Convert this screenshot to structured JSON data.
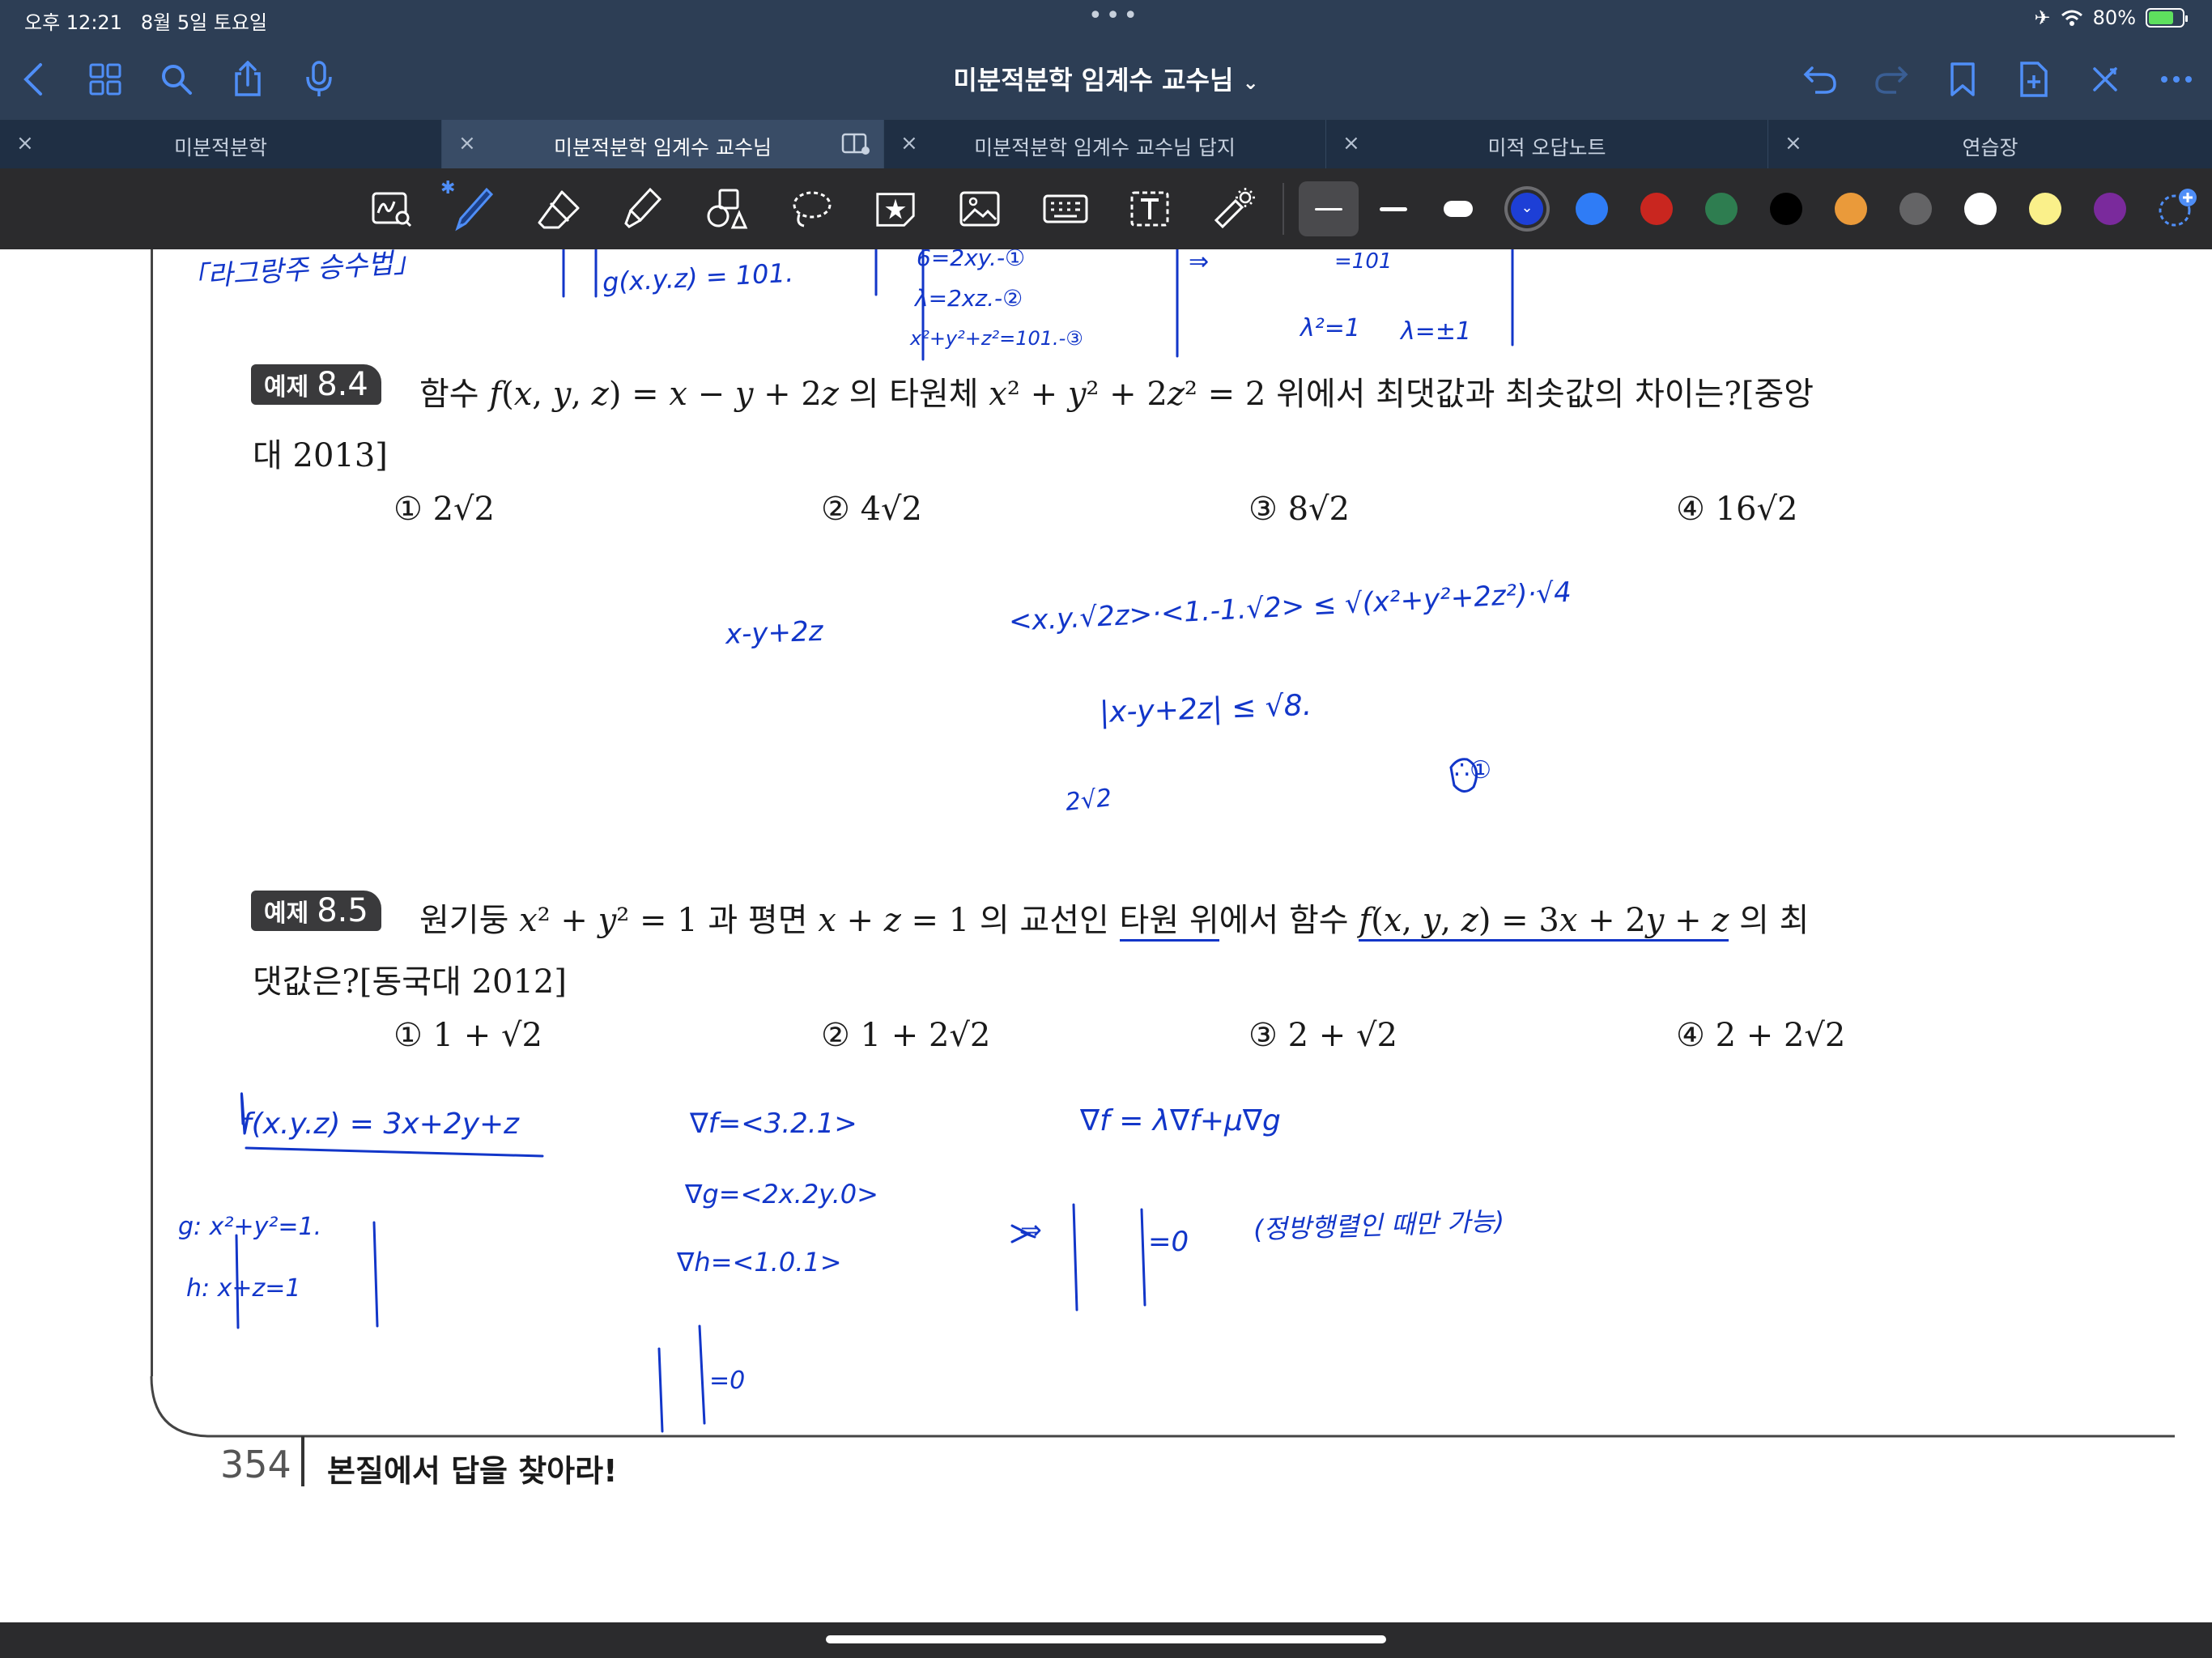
{
  "status": {
    "time": "오후 12:21",
    "date": "8월 5일 토요일",
    "dots": "•••",
    "airplane": "✈",
    "wifi": "wifi-icon",
    "battery": "80%",
    "battery_level": 0.8
  },
  "nav": {
    "title": "미분적분학 임계수 교수님",
    "title_chevron": "⌄",
    "left_icons": [
      "back-icon",
      "grid-icon",
      "search-icon",
      "share-icon",
      "microphone-icon"
    ],
    "right_icons": [
      "undo-icon",
      "redo-icon",
      "bookmark-icon",
      "add-page-icon",
      "close-icon",
      "more-icon"
    ]
  },
  "tabs": [
    {
      "label": "미분적분학",
      "active": false
    },
    {
      "label": "미분적분학 임계수 교수님",
      "active": true
    },
    {
      "label": "미분적분학 임계수 교수님 답지",
      "active": false
    },
    {
      "label": "미적 오답노트",
      "active": false
    },
    {
      "label": "연습장",
      "active": false
    }
  ],
  "toolbar": {
    "tools": [
      "handwriting-search-icon",
      "pen-icon",
      "eraser-icon",
      "highlighter-icon",
      "shapes-icon",
      "lasso-icon",
      "sticker-icon",
      "image-icon",
      "keyboard-icon",
      "text-icon",
      "laser-pointer-icon"
    ],
    "bluetooth": "✱",
    "stroke_widths": [
      "thin",
      "medium",
      "thick"
    ],
    "colors": [
      "#1d3fd6",
      "#2f7cf6",
      "#c9261f",
      "#2e7d50",
      "#000000",
      "#ea9a3a",
      "#646466",
      "#ffffff",
      "#faf08a",
      "#7a2a9c"
    ],
    "selected_color": "#1d3fd6",
    "selected_chevron": "⌄"
  },
  "document": {
    "example_84": {
      "badge_word": "예제",
      "badge_num": "8.4",
      "line1": "함수 𝑓(𝑥, 𝑦, 𝑧) = 𝑥 − 𝑦 + 2𝑧 의 타원체 𝑥² + 𝑦² + 2𝑧² = 2  위에서 최댓값과 최솟값의 차이는?[중앙",
      "line2": "대 2013]",
      "choices": [
        "① 2√2",
        "② 4√2",
        "③ 8√2",
        "④ 16√2"
      ]
    },
    "example_85": {
      "badge_word": "예제",
      "badge_num": "8.5",
      "line1_a": "원기둥 𝑥² + 𝑦² = 1 과 평면 𝑥 + 𝑧 = 1 의 교선인 ",
      "line1_b": "타원 위",
      "line1_c": "에서 함수 ",
      "line1_d": "𝑓(𝑥, 𝑦, 𝑧) = 3𝑥 + 2𝑦 + 𝑧",
      "line1_e": " 의 최",
      "line2": "댓값은?[동국대 2012]",
      "choices": [
        "① 1 + √2",
        "② 1 + 2√2",
        "③ 2 + √2",
        "④ 2 + 2√2"
      ]
    },
    "page_number": "354",
    "footer": "본질에서 답을 찾아라!"
  },
  "handwriting": {
    "ink_color": "#1236c9",
    "notes": [
      "「라그랑주 승수법」",
      "g(x.y.z) = 101.",
      "6=2xy.-①",
      "λ=2xz.-②",
      "x²+y²+z²=101.-③",
      "⇒",
      "=101",
      "λ²=1",
      "λ=±1",
      "x-y+2z",
      "<x.y.√2z>·<1.-1.√2> ≤ √(x²+y²+2z²)·√4",
      "|x-y+2z| ≤ √8.",
      "∴①",
      "2√2",
      "f(x.y.z) = 3x+2y+z",
      "g: x²+y²=1.",
      "h: x+z=1",
      "∇f=<3.2.1>",
      "∇g=<2x.2y.0>",
      "∇h=<1.0.1>",
      "=0",
      "∇f = λ∇f+μ∇g",
      "⇒",
      "=0",
      "(정방행렬인 때만 가능)"
    ]
  }
}
